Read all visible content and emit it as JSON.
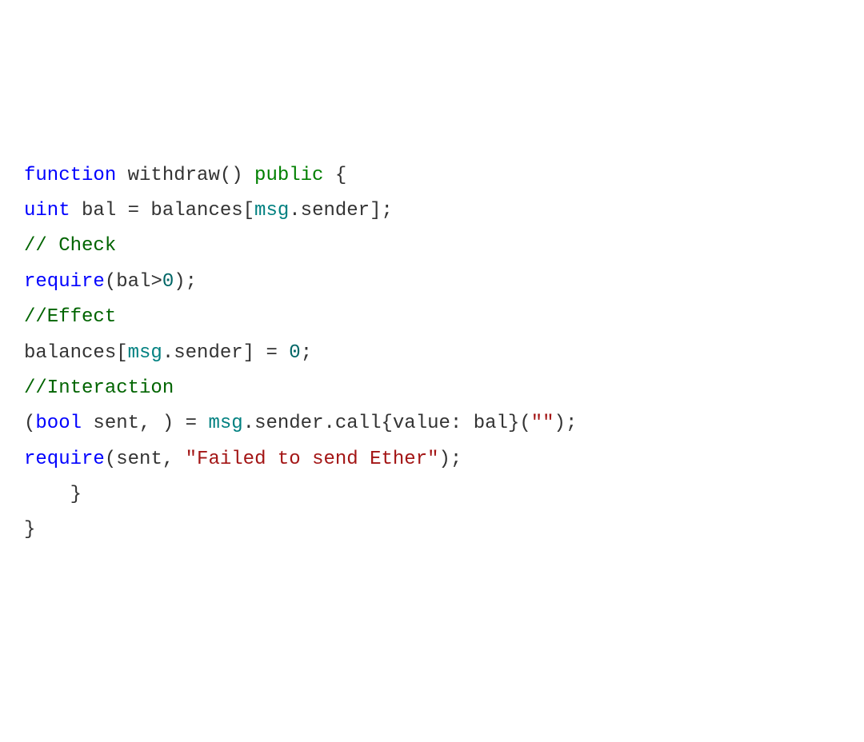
{
  "code": {
    "l1": {
      "t1": "function",
      "t2": " withdraw() ",
      "t3": "public",
      "t4": " {"
    },
    "l2": {
      "t1": "uint",
      "t2": " bal = balances[",
      "t3": "msg",
      "t4": ".sender];"
    },
    "l3": {
      "t1": "// Check"
    },
    "l4": {
      "t1": "require",
      "t2": "(bal>",
      "t3": "0",
      "t4": ");"
    },
    "l5": {
      "t1": "//Effect"
    },
    "l6": {
      "t1": "balances[",
      "t2": "msg",
      "t3": ".sender] = ",
      "t4": "0",
      "t5": ";"
    },
    "l7": {
      "t1": "//Interaction"
    },
    "l8": {
      "t1": "(",
      "t2": "bool",
      "t3": " sent, ) = ",
      "t4": "msg",
      "t5": ".sender.call{value: bal}(",
      "t6": "\"\"",
      "t7": ");"
    },
    "l9": {
      "t1": "require",
      "t2": "(sent, ",
      "t3": "\"Failed to send Ether\"",
      "t4": ");"
    },
    "l10": {
      "t1": "    }"
    },
    "l11": {
      "t1": "}"
    }
  }
}
